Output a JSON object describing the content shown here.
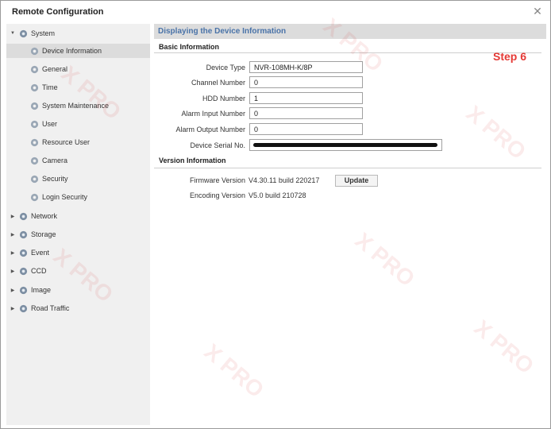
{
  "window": {
    "title": "Remote Configuration"
  },
  "icons": {
    "close": "close-icon",
    "gear": "gear-icon",
    "expand": "triangle-right-icon",
    "collapse": "triangle-down-icon"
  },
  "sidebar": {
    "system": "System",
    "system_children": [
      "Device Information",
      "General",
      "Time",
      "System Maintenance",
      "User",
      "Resource User",
      "Camera",
      "Security",
      "Login Security"
    ],
    "groups": [
      "Network",
      "Storage",
      "Event",
      "CCD",
      "Image",
      "Road Traffic"
    ]
  },
  "main": {
    "header": "Displaying the Device Information",
    "basic_title": "Basic Information",
    "fields": {
      "device_type_label": "Device Type",
      "device_type_value": "NVR-108MH-K/8P",
      "channel_label": "Channel Number",
      "channel_value": "0",
      "hdd_label": "HDD Number",
      "hdd_value": "1",
      "alarm_in_label": "Alarm Input Number",
      "alarm_in_value": "0",
      "alarm_out_label": "Alarm Output Number",
      "alarm_out_value": "0",
      "serial_label": "Device Serial No."
    },
    "version_title": "Version Information",
    "firmware_label": "Firmware Version",
    "firmware_value": "V4.30.11 build 220217",
    "update_button": "Update",
    "encoding_label": "Encoding Version",
    "encoding_value": "V5.0 build 210728"
  },
  "annotation": {
    "step": "Step 6"
  },
  "watermark": {
    "text": "X PRO"
  },
  "colors": {
    "accent": "#4a73a8",
    "step": "#e53935",
    "sidebar_bg": "#f0f0f0",
    "header_bg": "#dcdcdc"
  }
}
